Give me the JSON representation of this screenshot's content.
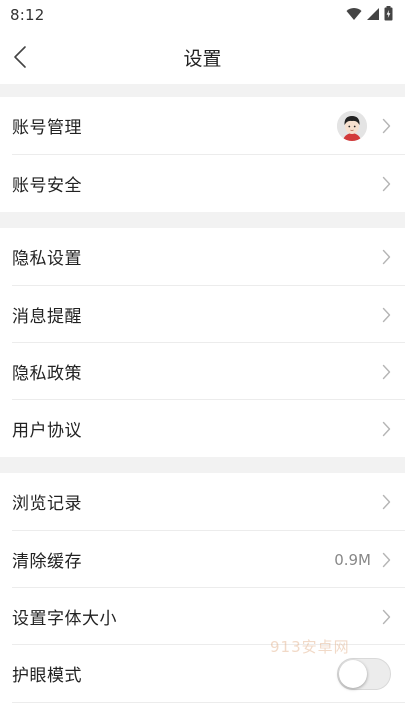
{
  "status_bar": {
    "time": "8:12",
    "icons": [
      "wifi-icon",
      "signal-icon",
      "battery-icon"
    ]
  },
  "header": {
    "title": "设置",
    "back_icon": "chevron-left-icon"
  },
  "sections": [
    {
      "items": [
        {
          "label": "账号管理",
          "has_avatar": true,
          "chevron": true
        },
        {
          "label": "账号安全",
          "chevron": true
        }
      ]
    },
    {
      "items": [
        {
          "label": "隐私设置",
          "chevron": true
        },
        {
          "label": "消息提醒",
          "chevron": true
        },
        {
          "label": "隐私政策",
          "chevron": true
        },
        {
          "label": "用户协议",
          "chevron": true
        }
      ]
    },
    {
      "items": [
        {
          "label": "浏览记录",
          "chevron": true
        },
        {
          "label": "清除缓存",
          "value": "0.9M",
          "chevron": true
        },
        {
          "label": "设置字体大小",
          "chevron": true
        },
        {
          "label": "护眼模式",
          "toggle": true,
          "toggle_on": false
        }
      ]
    }
  ],
  "watermark": "913安卓网",
  "colors": {
    "background": "#ffffff",
    "separator": "#f2f2f2",
    "divider": "#ececec",
    "chevron": "#b5b5b5"
  }
}
